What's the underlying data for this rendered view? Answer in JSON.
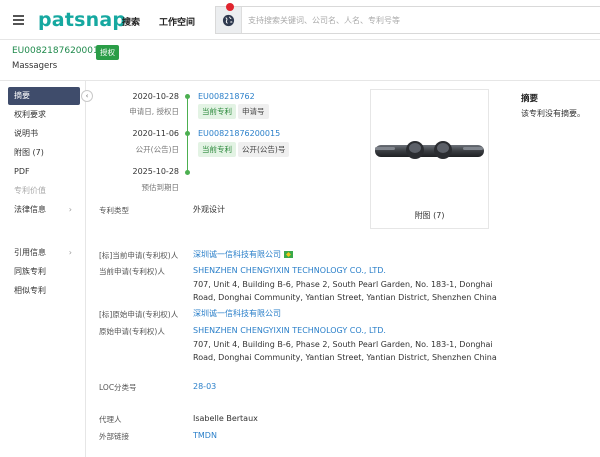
{
  "header": {
    "logo": "patsnap",
    "nav_search": "搜索",
    "nav_workspace": "工作空间",
    "search_placeholder": "支持搜索关键词、公司名、人名、专利号等"
  },
  "patent": {
    "number": "EU008218762000 1S",
    "number_display": "EU00821876200015",
    "status_badge": "授权",
    "title": "Massagers"
  },
  "sidebar": {
    "items": [
      {
        "label": "摘要"
      },
      {
        "label": "权利要求"
      },
      {
        "label": "说明书"
      },
      {
        "label": "附图 (7)"
      },
      {
        "label": "PDF"
      },
      {
        "label": "专利价值"
      },
      {
        "label": "法律信息"
      },
      {
        "label": "引用信息"
      },
      {
        "label": "同族专利"
      },
      {
        "label": "相似专利"
      }
    ]
  },
  "timeline": {
    "events": [
      {
        "date": "2020-10-28",
        "label": "申请日, 授权日",
        "link": "EU008218762",
        "tags": [
          "当前专利",
          "申请号"
        ]
      },
      {
        "date": "2020-11-06",
        "label": "公开(公告)日",
        "link": "EU00821876200015",
        "tags": [
          "当前专利",
          "公开(公告)号"
        ]
      },
      {
        "date": "2025-10-28",
        "label": "预估到期日"
      }
    ]
  },
  "figure": {
    "caption": "附图 (7)"
  },
  "abstract": {
    "title": "摘要",
    "text": "该专利没有摘要。"
  },
  "fields": {
    "patent_type_label": "专利类型",
    "patent_type_value": "外观设计",
    "std_current_assignee_label": "[标]当前申请(专利权)人",
    "std_current_assignee_value": "深圳诚一信科技有限公司",
    "current_assignee_label": "当前申请(专利权)人",
    "current_assignee_name": "SHENZHEN CHENGYIXIN TECHNOLOGY CO., LTD.",
    "current_assignee_addr1": "707, Unit 4, Building B-6, Phase 2, South Pearl Garden, No. 183-1, Donghai",
    "current_assignee_addr2": "Road, Donghai Community, Yantian Street, Yantian District, Shenzhen China",
    "std_original_assignee_label": "[标]原始申请(专利权)人",
    "std_original_assignee_value": "深圳诚一信科技有限公司",
    "original_assignee_label": "原始申请(专利权)人",
    "original_assignee_name": "SHENZHEN CHENGYIXIN TECHNOLOGY CO., LTD.",
    "original_assignee_addr1": "707, Unit 4, Building B-6, Phase 2, South Pearl Garden, No. 183-1, Donghai",
    "original_assignee_addr2": "Road, Donghai Community, Yantian Street, Yantian District, Shenzhen China",
    "loc_label": "LOC分类号",
    "loc_value": "28-03",
    "agent_label": "代理人",
    "agent_value": "Isabelle Bertaux",
    "external_link_label": "外部链接",
    "external_link_value": "TMDN"
  },
  "colors": {
    "brand": "#16a8a0",
    "accent_green": "#2a9d47",
    "link_blue": "#2a7fc9",
    "sidebar_active": "#3f4c6b"
  }
}
